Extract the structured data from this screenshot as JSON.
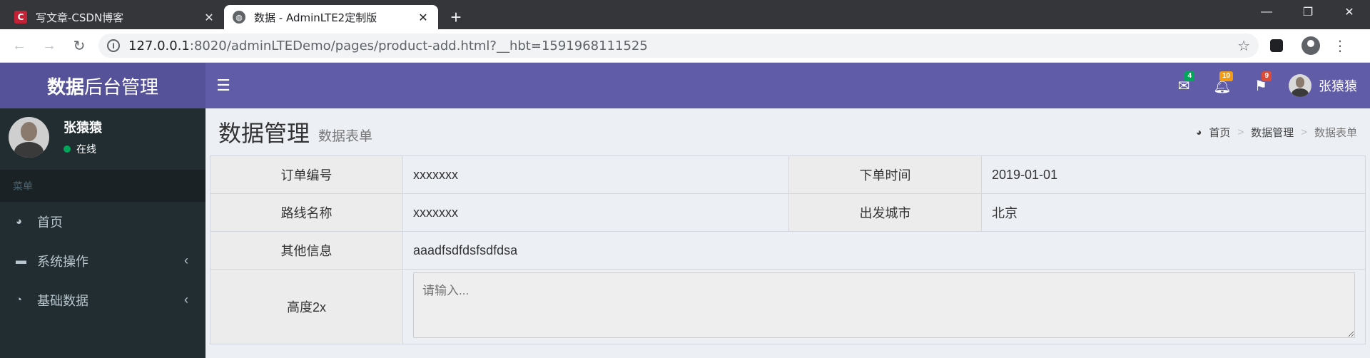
{
  "browser": {
    "tabs": [
      {
        "favicon": "C",
        "title": "写文章-CSDN博客"
      },
      {
        "favicon": "🌐",
        "title": "数据 - AdminLTE2定制版"
      }
    ],
    "url_host": "127.0.0.1",
    "url_rest": ":8020/adminLTEDemo/pages/product-add.html?__hbt=1591968111525"
  },
  "header": {
    "logo_bold": "数据",
    "logo_rest": "后台管理",
    "badges": {
      "messages": "4",
      "notifications": "10",
      "tasks": "9"
    },
    "user_name": "张猿猿"
  },
  "sidebar": {
    "user_name": "张猿猿",
    "user_status": "在线",
    "menu_header": "菜单",
    "items": [
      {
        "label": "首页"
      },
      {
        "label": "系统操作"
      },
      {
        "label": "基础数据"
      }
    ]
  },
  "content": {
    "title": "数据管理",
    "subtitle": "数据表单",
    "breadcrumb": [
      "首页",
      "数据管理",
      "数据表单"
    ],
    "form": {
      "order_no_label": "订单编号",
      "order_no_value": "xxxxxxx",
      "order_time_label": "下单时间",
      "order_time_value": "2019-01-01",
      "route_label": "路线名称",
      "route_value": "xxxxxxx",
      "city_label": "出发城市",
      "city_value": "北京",
      "other_label": "其他信息",
      "other_value": "aaadfsdfdsfsdfdsa",
      "height_label": "高度2x",
      "height_placeholder": "请输入..."
    }
  }
}
